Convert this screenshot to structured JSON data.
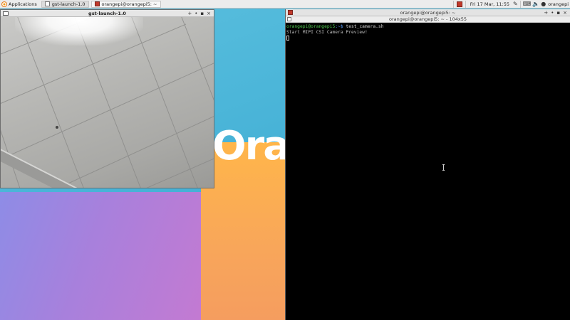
{
  "panel": {
    "applications_label": "Applications",
    "tasks": [
      {
        "label": "gst-launch-1.0"
      },
      {
        "label": "orangepi@orangepi5: ~"
      }
    ],
    "clock": "Fri 17 Mar, 11:55",
    "user": "orangepi"
  },
  "wallpaper": {
    "logo_text": "Oran"
  },
  "gst_window": {
    "title": "gst-launch-1.0"
  },
  "terminal": {
    "title": "orangepi@orangepi5: ~",
    "menubar_title": "orangepi@orangepi5: ~ - 104x55",
    "prompt_user": "orangepi@orangepi5",
    "prompt_path": ":~$",
    "command": " test_camera.sh",
    "output": "Start MIPI CSI Camera Preview!"
  },
  "colors": {
    "panel_bg": "#ececec",
    "terminal_bg": "#000000",
    "prompt_green": "#4ec84e",
    "wallpaper_blue": "#4cb6d9",
    "wallpaper_orange": "#f8a65a",
    "wallpaper_purple": "#a880dc"
  }
}
